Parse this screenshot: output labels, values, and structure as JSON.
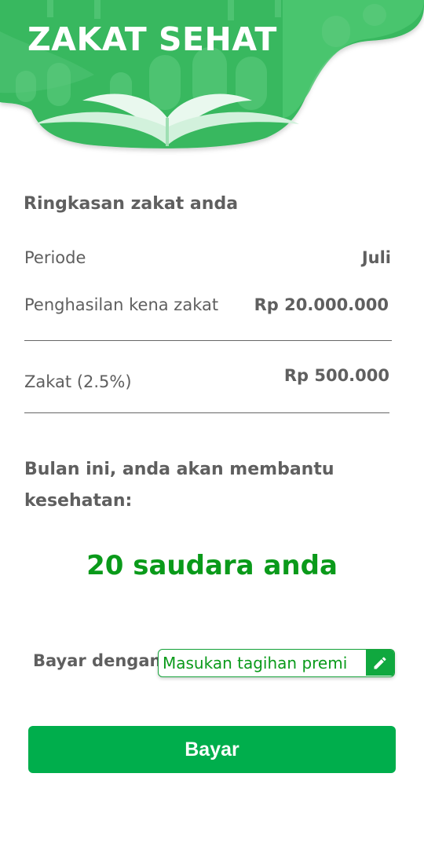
{
  "header": {
    "title": "ZAKAT SEHAT"
  },
  "summary": {
    "title": "Ringkasan zakat anda",
    "period_label": "Periode",
    "period_value": "Juli",
    "income_label": "Penghasilan kena zakat",
    "income_value": "Rp 20.000.000",
    "zakat_label": "Zakat (2.5%)",
    "zakat_value": "Rp 500.000"
  },
  "impact": {
    "text": "Bulan ini, anda akan membantu kesehatan:",
    "count_text": "20 saudara anda"
  },
  "payment": {
    "label": "Bayar dengan",
    "input_placeholder": "Masukan tagihan premi",
    "edit_icon": "pencil-icon",
    "button_label": "Bayar"
  },
  "colors": {
    "brand_green": "#2bb65a",
    "accent_text_green": "#0a9a1a",
    "button_green": "#00ae4c",
    "text_gray": "#5f5f5f"
  }
}
